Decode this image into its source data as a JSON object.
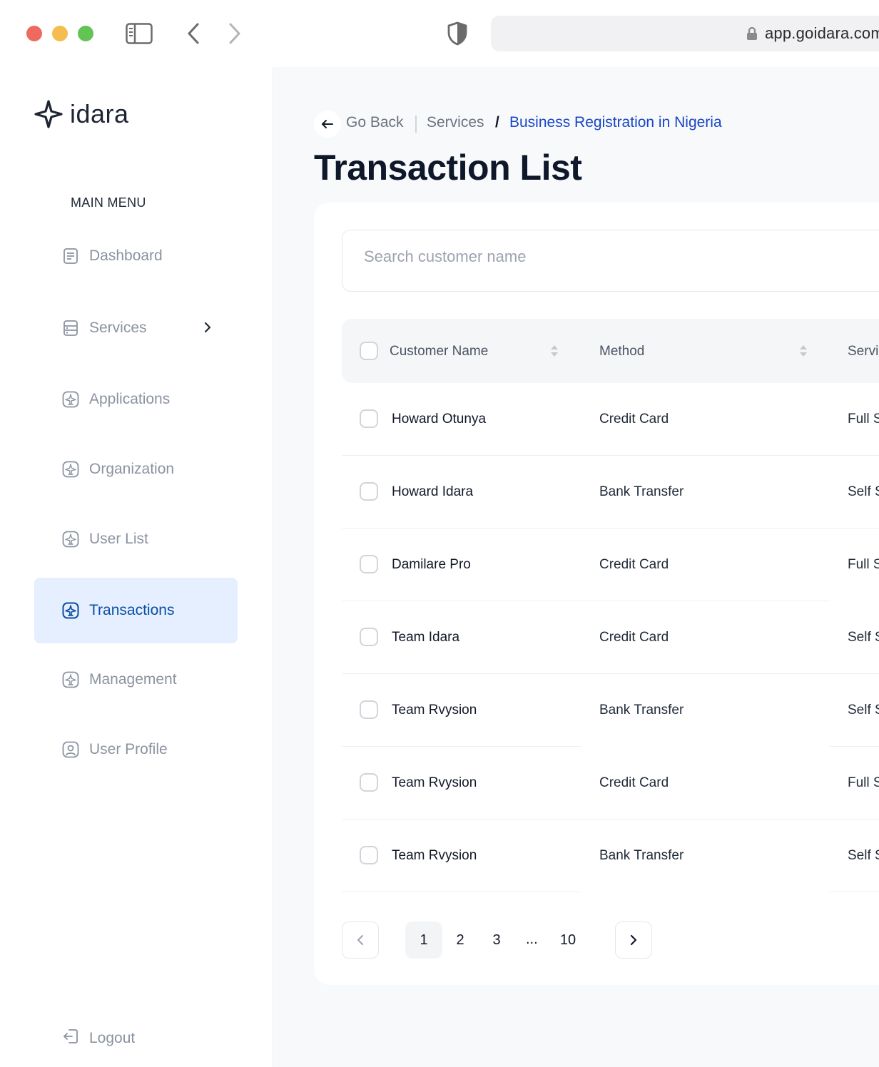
{
  "browser": {
    "url": "app.goidara.com",
    "colors": {
      "close": "#ee6a5f",
      "minimize": "#f5bd4f",
      "maximize": "#61c454"
    }
  },
  "sidebar": {
    "logo_text": "idara",
    "menu_title": "MAIN MENU",
    "items": [
      {
        "label": "Dashboard",
        "icon": "document-icon",
        "active": false
      },
      {
        "label": "Services",
        "icon": "server-icon",
        "active": false,
        "has_submenu": true
      },
      {
        "label": "Applications",
        "icon": "airplane-badge-icon",
        "active": false
      },
      {
        "label": "Organization",
        "icon": "airplane-badge-icon",
        "active": false
      },
      {
        "label": "User List",
        "icon": "airplane-badge-icon",
        "active": false
      },
      {
        "label": "Transactions",
        "icon": "airplane-badge-icon",
        "active": true
      },
      {
        "label": "Management",
        "icon": "airplane-badge-icon",
        "active": false
      },
      {
        "label": "User Profile",
        "icon": "user-square-icon",
        "active": false
      }
    ],
    "logout_label": "Logout"
  },
  "breadcrumb": {
    "back_label": "Go Back",
    "services_label": "Services",
    "separator": "/",
    "current": "Business Registration in Nigeria"
  },
  "page_title": "Transaction List",
  "search": {
    "placeholder": "Search customer name",
    "value": ""
  },
  "table": {
    "columns": [
      "Customer Name",
      "Method",
      "Service"
    ],
    "rows": [
      {
        "name": "Howard Otunya",
        "method": "Credit Card",
        "service": "Full Service"
      },
      {
        "name": "Howard Idara",
        "method": "Bank Transfer",
        "service": "Self Service"
      },
      {
        "name": "Damilare Pro",
        "method": "Credit Card",
        "service": "Full Service"
      },
      {
        "name": "Team Idara",
        "method": "Credit Card",
        "service": "Self Service"
      },
      {
        "name": "Team Rvysion",
        "method": "Bank Transfer",
        "service": "Self Service"
      },
      {
        "name": "Team Rvysion",
        "method": "Credit Card",
        "service": "Full Service"
      },
      {
        "name": "Team Rvysion",
        "method": "Bank Transfer",
        "service": "Self Service"
      }
    ]
  },
  "pagination": {
    "pages": [
      "1",
      "2",
      "3",
      "10"
    ],
    "ellipsis": "...",
    "current": "1"
  },
  "colors": {
    "accent": "#1746c5",
    "active_bg": "#e5efff",
    "active_text": "#0b4ea2",
    "muted_text": "#8b93a1",
    "main_bg": "#f8f9fa"
  }
}
